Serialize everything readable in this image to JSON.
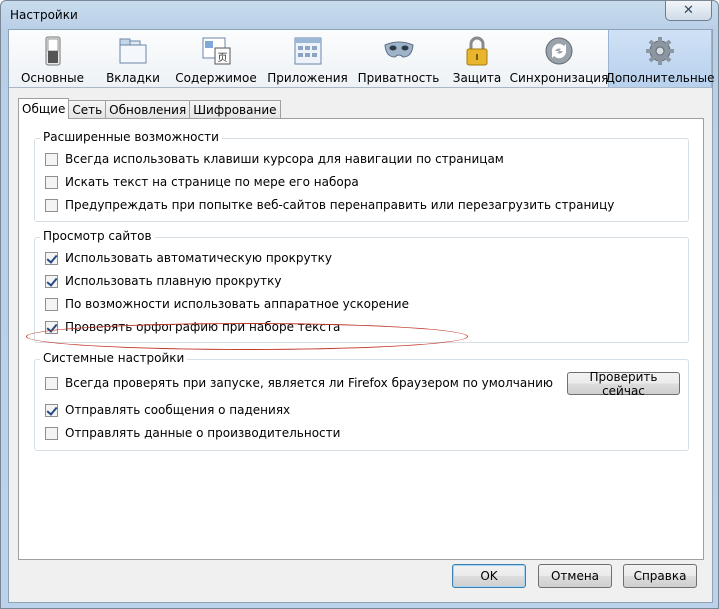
{
  "window": {
    "title": "Настройки",
    "close_glyph": "✕"
  },
  "toolbar": {
    "items": [
      {
        "label": "Основные",
        "icon": "switch-icon"
      },
      {
        "label": "Вкладки",
        "icon": "tabs-icon"
      },
      {
        "label": "Содержимое",
        "icon": "content-icon"
      },
      {
        "label": "Приложения",
        "icon": "applications-icon"
      },
      {
        "label": "Приватность",
        "icon": "mask-icon"
      },
      {
        "label": "Защита",
        "icon": "padlock-icon"
      },
      {
        "label": "Синхронизация",
        "icon": "sync-icon"
      },
      {
        "label": "Дополнительные",
        "icon": "gear-icon"
      }
    ],
    "selected_index": 7
  },
  "subtabs": [
    "Общие",
    "Сеть",
    "Обновления",
    "Шифрование"
  ],
  "groups": {
    "accessibility": {
      "legend": "Расширенные возможности",
      "options": [
        {
          "label": "Всегда использовать клавиши курсора для навигации по страницам",
          "checked": false
        },
        {
          "label": "Искать текст на странице по мере его набора",
          "checked": false
        },
        {
          "label": "Предупреждать при попытке веб-сайтов перенаправить или перезагрузить страницу",
          "checked": false
        }
      ]
    },
    "browsing": {
      "legend": "Просмотр сайтов",
      "options": [
        {
          "label": "Использовать автоматическую прокрутку",
          "checked": true
        },
        {
          "label": "Использовать плавную прокрутку",
          "checked": true
        },
        {
          "label": "По возможности использовать аппаратное ускорение",
          "checked": false
        },
        {
          "label": "Проверять орфографию при наборе текста",
          "checked": true
        }
      ]
    },
    "system": {
      "legend": "Системные настройки",
      "options": [
        {
          "label": "Всегда проверять при запуске, является ли Firefox браузером по умолчанию",
          "checked": false
        },
        {
          "label": "Отправлять сообщения о падениях",
          "checked": true
        },
        {
          "label": "Отправлять данные о производительности",
          "checked": false
        }
      ],
      "check_now_label": "Проверить сейчас"
    }
  },
  "buttons": {
    "ok": "OK",
    "cancel": "Отмена",
    "help": "Справка"
  },
  "colors": {
    "annotation": "#c0392b",
    "selected_tab": "#b8d1ee"
  }
}
